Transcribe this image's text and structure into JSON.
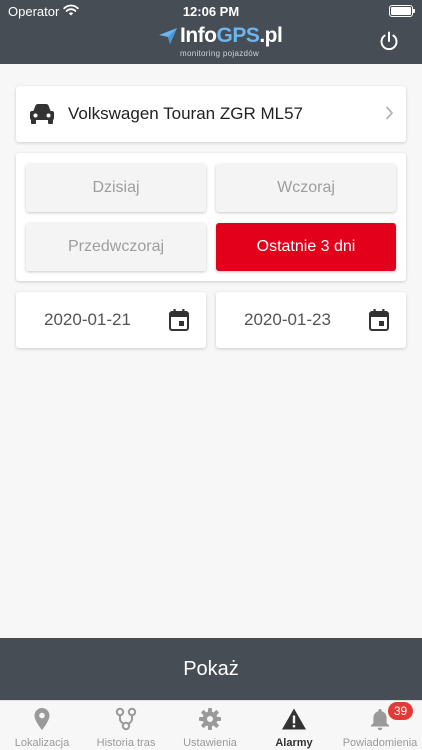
{
  "statusbar": {
    "carrier": "Operator",
    "time": "12:06 PM"
  },
  "header": {
    "logo_main": "Info",
    "logo_accent": "GPS",
    "logo_suffix": ".pl",
    "logo_sub": "monitoring pojazdów"
  },
  "vehicle": {
    "name": "Volkswagen Touran ZGR ML57",
    "icon": "car-icon"
  },
  "range": {
    "options": [
      {
        "label": "Dzisiaj",
        "active": false
      },
      {
        "label": "Wczoraj",
        "active": false
      },
      {
        "label": "Przedwczoraj",
        "active": false
      },
      {
        "label": "Ostatnie 3 dni",
        "active": true
      }
    ]
  },
  "dates": {
    "from": "2020-01-21",
    "to": "2020-01-23"
  },
  "show_button": "Pokaż",
  "tabs": [
    {
      "label": "Lokalizacja",
      "icon": "location-pin-icon"
    },
    {
      "label": "Historia tras",
      "icon": "route-icon"
    },
    {
      "label": "Ustawienia",
      "icon": "gear-icon"
    },
    {
      "label": "Alarmy",
      "icon": "warning-icon",
      "active": true
    },
    {
      "label": "Powiadomienia",
      "icon": "bell-icon",
      "badge": "39"
    }
  ],
  "colors": {
    "header": "#464d55",
    "accent": "#e2001a",
    "badge": "#e53935"
  }
}
